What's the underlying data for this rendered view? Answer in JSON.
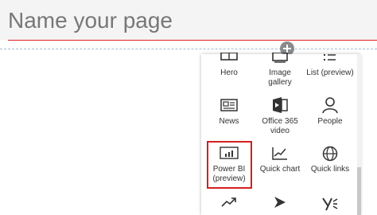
{
  "page": {
    "title_placeholder": "Name your page"
  },
  "colors": {
    "title_underline": "#e02020",
    "highlight": "#d42020",
    "icon": "#333333"
  },
  "picker": {
    "rows": [
      [
        {
          "label": "Hero",
          "icon": "hero-icon"
        },
        {
          "label": "Image gallery",
          "icon": "image-gallery-icon"
        },
        {
          "label": "List (preview)",
          "icon": "list-icon"
        }
      ],
      [
        {
          "label": "News",
          "icon": "news-icon"
        },
        {
          "label": "Office 365 video",
          "icon": "office-365-video-icon"
        },
        {
          "label": "People",
          "icon": "person-icon"
        }
      ],
      [
        {
          "label": "Power BI (preview)",
          "icon": "power-bi-icon",
          "highlighted": true
        },
        {
          "label": "Quick chart",
          "icon": "line-chart-icon"
        },
        {
          "label": "Quick links",
          "icon": "globe-icon"
        }
      ],
      [
        {
          "label": "",
          "icon": "trending-icon"
        },
        {
          "label": "",
          "icon": "stream-play-icon"
        },
        {
          "label": "",
          "icon": "yammer-icon"
        }
      ]
    ]
  }
}
